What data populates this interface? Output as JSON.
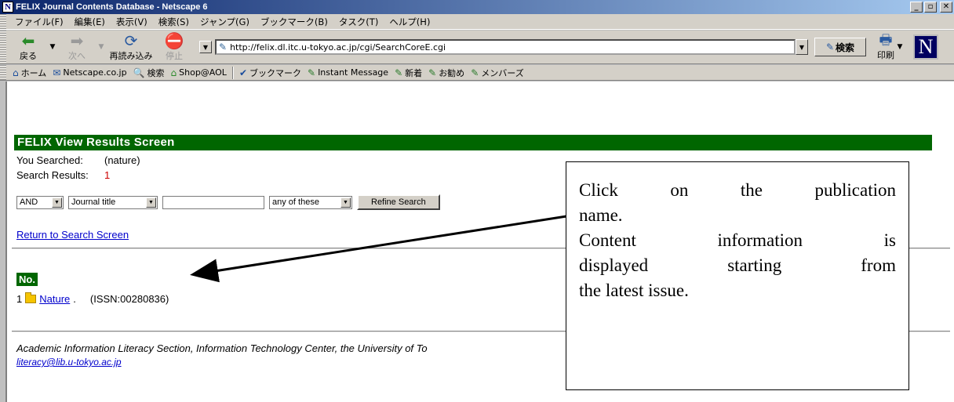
{
  "window": {
    "title": "FELIX  Journal Contents Database - Netscape 6",
    "app_icon": "N"
  },
  "menu": [
    "ファイル(F)",
    "編集(E)",
    "表示(V)",
    "検索(S)",
    "ジャンプ(G)",
    "ブックマーク(B)",
    "タスク(T)",
    "ヘルプ(H)"
  ],
  "nav": {
    "back": "戻る",
    "forward": "次へ",
    "reload": "再読み込み",
    "stop": "停止",
    "url": "http://felix.dl.itc.u-tokyo.ac.jp/cgi/SearchCoreE.cgi",
    "search": "検索",
    "print": "印刷",
    "logo": "N"
  },
  "personal_toolbar": [
    "ホーム",
    "Netscape.co.jp",
    "検索",
    "Shop@AOL",
    "ブックマーク",
    "Instant Message",
    "新着",
    "お勧め",
    "メンバーズ"
  ],
  "page": {
    "header": "FELIX  View Results Screen",
    "you_searched_label": "You Searched:",
    "you_searched_value": "(nature)",
    "results_label": "Search Results:",
    "results_count": "1",
    "operator": "AND",
    "field": "Journal title",
    "mode": "any of these",
    "refine_button": "Refine Search",
    "return_link": "Return to Search Screen",
    "no_label": "No.",
    "result_index": "1",
    "result_title": "Nature",
    "result_issn": "(ISSN:00280836)",
    "footer_text": "Academic Information Literacy Section, Information Technology Center, the University of To",
    "footer_email": "literacy@lib.u-tokyo.ac.jp"
  },
  "callout": {
    "line1": "Click on the publication",
    "line2": "name.",
    "line3": "Content information is",
    "line4": "displayed starting from",
    "line5": "the latest issue."
  }
}
